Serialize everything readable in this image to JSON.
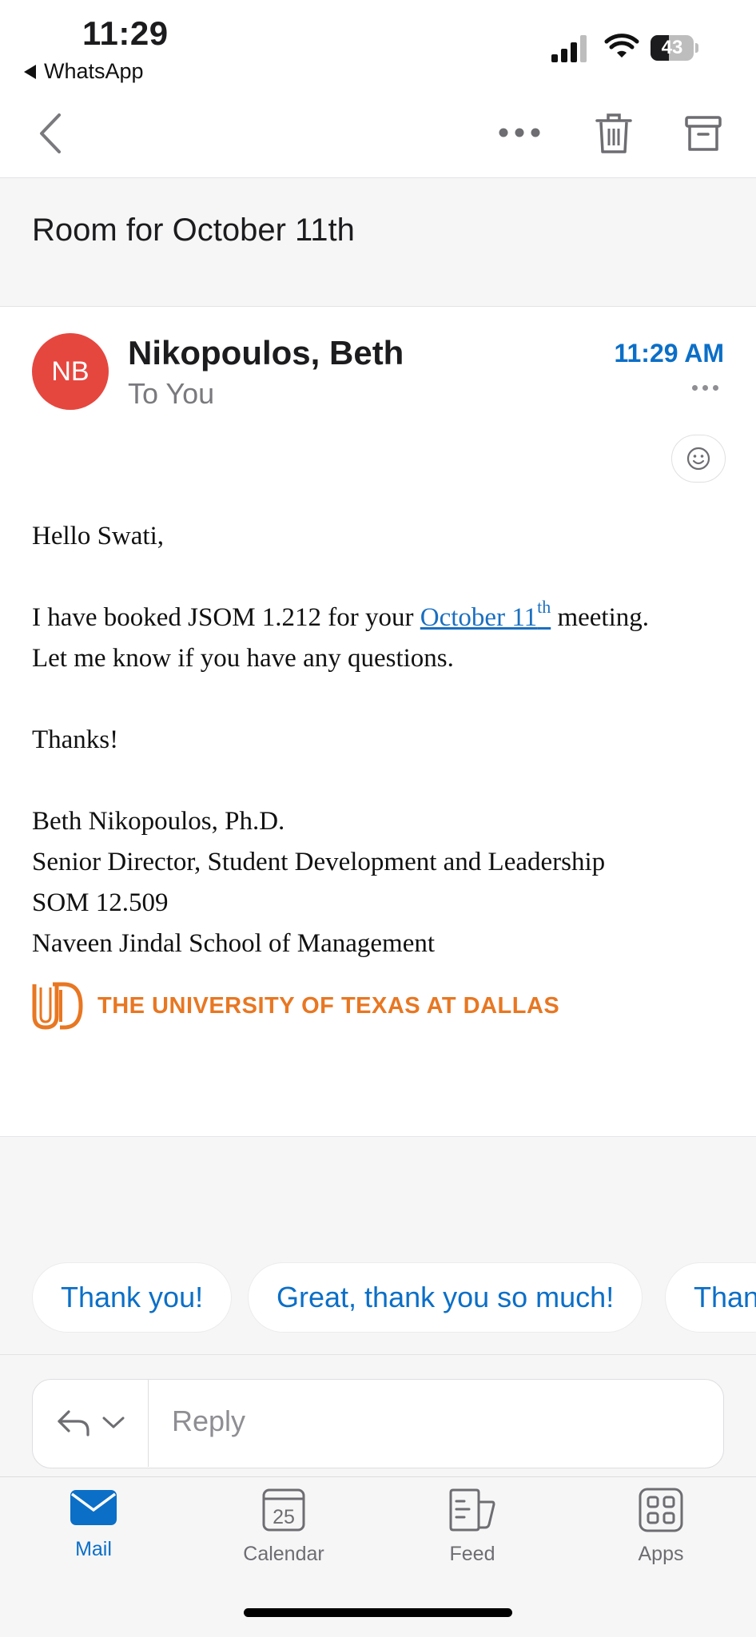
{
  "status_bar": {
    "time": "11:29",
    "back_app": "WhatsApp",
    "battery_percent": 43
  },
  "toolbar": {
    "back_icon": "chevron-left-icon",
    "more_icon": "more-horizontal-icon",
    "delete_icon": "trash-icon",
    "archive_icon": "archive-icon"
  },
  "email": {
    "subject": "Room for October 11th",
    "sender": {
      "initials": "NB",
      "name": "Nikopoulos, Beth",
      "avatar_color": "#e5473f"
    },
    "recipient_line": "To You",
    "time": "11:29 AM",
    "body": {
      "greeting": "Hello Swati,",
      "line1_pre": "I have booked JSOM 1.212 for your",
      "link_text": "October 11",
      "link_sup": "th",
      "line1_post": "meeting.",
      "line2": "Let me know if you have any questions.",
      "thanks": "Thanks!",
      "signature": [
        "Beth Nikopoulos, Ph.D.",
        "Senior Director, Student Development and Leadership",
        "SOM 12.509",
        "Naveen Jindal School of Management"
      ],
      "logo_text": "THE UNIVERSITY OF TEXAS AT DALLAS",
      "logo_color": "#e87722"
    }
  },
  "quick_replies": [
    "Thank you!",
    "Great, thank you so much!",
    "Than"
  ],
  "reply": {
    "placeholder": "Reply"
  },
  "tabs": [
    {
      "label": "Mail",
      "icon": "mail-icon",
      "active": true
    },
    {
      "label": "Calendar",
      "icon": "calendar-icon",
      "day": "25",
      "active": false
    },
    {
      "label": "Feed",
      "icon": "feed-icon",
      "active": false
    },
    {
      "label": "Apps",
      "icon": "apps-icon",
      "active": false
    }
  ],
  "colors": {
    "accent": "#0b6fc7",
    "link": "#1a6fc0"
  }
}
